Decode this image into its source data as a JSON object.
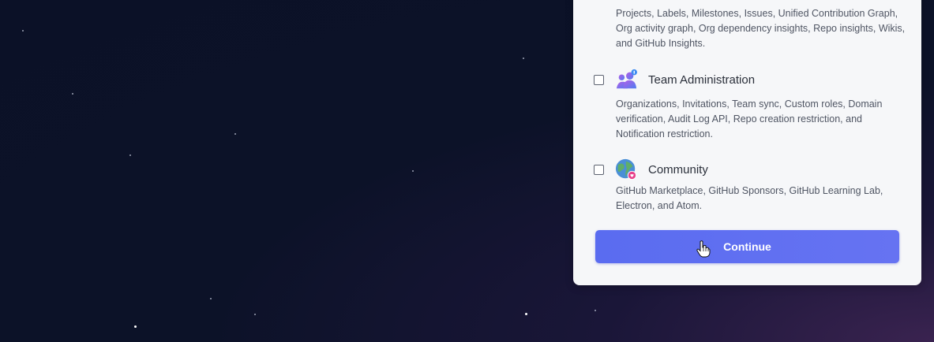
{
  "top_option": {
    "description": "Projects, Labels, Milestones, Issues, Unified Contribution Graph, Org activity graph, Org dependency insights, Repo insights, Wikis, and GitHub Insights."
  },
  "options": [
    {
      "title": "Team Administration",
      "icon": "team-people-icon",
      "checked": false,
      "description": "Organizations, Invitations, Team sync, Custom roles, Domain verification, Audit Log API, Repo creation restriction, and Notification restriction."
    },
    {
      "title": "Community",
      "icon": "globe-heart-icon",
      "checked": false,
      "description": "GitHub Marketplace, GitHub Sponsors, GitHub Learning Lab, Electron, and Atom."
    }
  ],
  "continue_button": {
    "label": "Continue",
    "color": "#5a6cf0"
  },
  "colors": {
    "background": "#0b1127",
    "card": "#f6f7f9",
    "accent": "#5a6cf0"
  }
}
